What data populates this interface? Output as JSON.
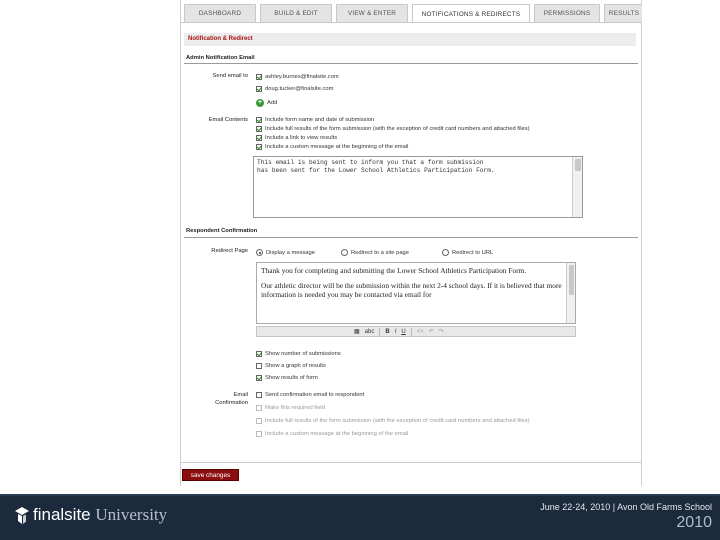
{
  "tabs": [
    {
      "label": "DASHBOARD"
    },
    {
      "label": "BUILD & EDIT"
    },
    {
      "label": "VIEW & ENTER"
    },
    {
      "label": "NOTIFICATIONS & REDIRECTS",
      "active": true
    },
    {
      "label": "PERMISSIONS"
    },
    {
      "label": "RESULTS"
    }
  ],
  "section_title": "Notification & Redirect",
  "admin": {
    "heading": "Admin Notification Email",
    "send_label": "Send email to",
    "emails": [
      "ashley.burnes@finalsite.com",
      "doug.tucker@finalsite.com"
    ],
    "add_label": "Add",
    "contents_label": "Email Contents",
    "contents": [
      "Include form name and date of submission",
      "Include full results of the form submission (with the exception of credit card numbers and attached files)",
      "Include a link to view results",
      "Include a custom message at the beginning of the email"
    ],
    "custom_message": "This email is being sent to inform you that a form submission\nhas been sent for the Lower School Athletics Participation Form."
  },
  "respondent": {
    "heading": "Respondent Confirmation",
    "redirect_label": "Redirect Page",
    "redirect_options": [
      "Display a message",
      "Redirect to a site page",
      "Redirect to URL"
    ],
    "message_p1": "Thank you for completing and submitting the Lower School Athletics Participation Form.",
    "message_p2": "Our athletic director will be the submission within the next 2-4 school days. If it is believed that more information is needed you may be contacted via email for",
    "toolbar": [
      "abc",
      "B",
      "I",
      "U",
      "<>",
      "↶",
      "↷"
    ],
    "display_options": [
      "Show number of submissions",
      "Show a graph of results",
      "Show results of form"
    ],
    "email_label": "Email Confirmation",
    "email_options": [
      "Send confirmation email to respondent",
      "Make this required field",
      "Include full results of the form submission (with the exception of credit card numbers and attached files)",
      "Include a custom message at the beginning of the email"
    ]
  },
  "save_label": "save changes",
  "footer": {
    "brand": "finalsite",
    "university": "University",
    "event": "June 22-24, 2010 | Avon Old Farms School",
    "year": "2010"
  }
}
